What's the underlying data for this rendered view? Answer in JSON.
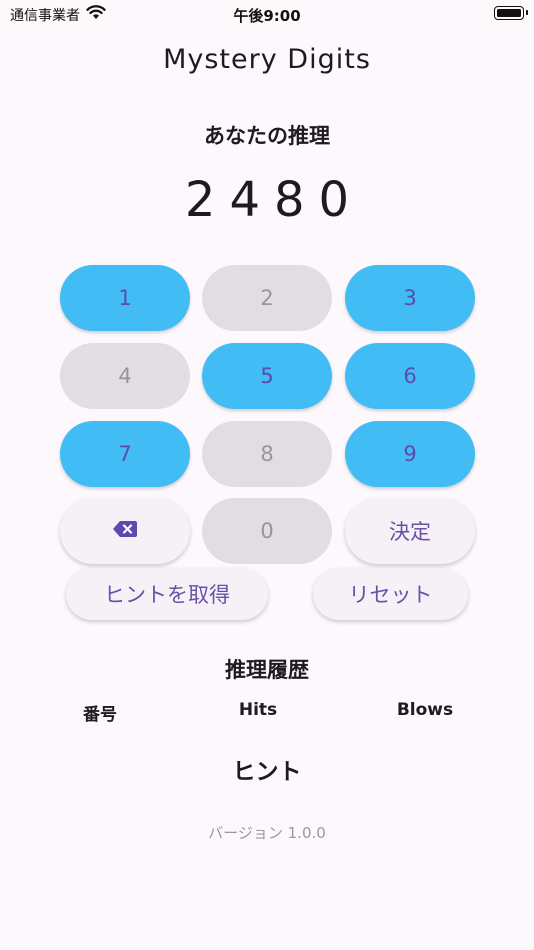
{
  "status_bar": {
    "carrier": "通信事業者",
    "time": "午後9:00"
  },
  "app": {
    "title": "Mystery Digits"
  },
  "guess": {
    "heading": "あなたの推理",
    "value": "2480"
  },
  "keypad": {
    "keys": [
      {
        "label": "1",
        "state": "enabled"
      },
      {
        "label": "2",
        "state": "used"
      },
      {
        "label": "3",
        "state": "enabled"
      },
      {
        "label": "4",
        "state": "used"
      },
      {
        "label": "5",
        "state": "enabled"
      },
      {
        "label": "6",
        "state": "enabled"
      },
      {
        "label": "7",
        "state": "enabled"
      },
      {
        "label": "8",
        "state": "used"
      },
      {
        "label": "9",
        "state": "enabled"
      }
    ],
    "backspace_icon": "backspace-icon",
    "zero": {
      "label": "0",
      "state": "used"
    },
    "submit_label": "決定"
  },
  "actions": {
    "hint_label": "ヒントを取得",
    "reset_label": "リセット"
  },
  "history": {
    "heading": "推理履歴",
    "columns": [
      "番号",
      "Hits",
      "Blows"
    ]
  },
  "hint": {
    "heading": "ヒント"
  },
  "footer": {
    "version": "バージョン 1.0.0"
  },
  "colors": {
    "accent": "#42bcf5",
    "primary_text": "#6a50a7",
    "disabled_key": "#e1dee1",
    "background": "#fcf8fc"
  }
}
